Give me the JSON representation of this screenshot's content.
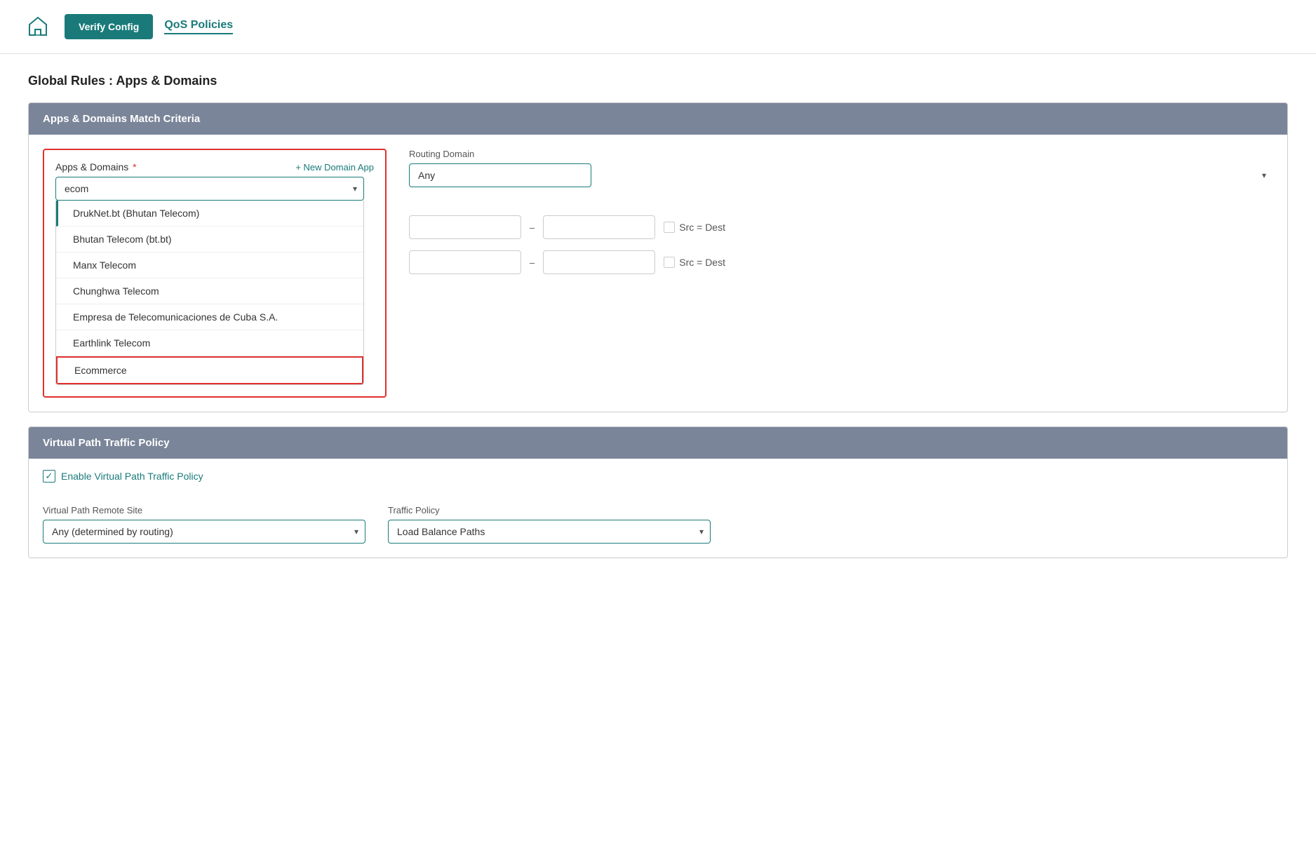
{
  "header": {
    "verify_config_label": "Verify Config",
    "qos_policies_label": "QoS Policies"
  },
  "page": {
    "title": "Global Rules : Apps & Domains"
  },
  "match_criteria_section": {
    "header": "Apps & Domains Match Criteria",
    "apps_domains_label": "Apps & Domains",
    "new_domain_app_link": "+ New Domain App",
    "search_value": "ecom",
    "dropdown_items": [
      {
        "label": "DrukNet.bt (Bhutan Telecom)",
        "first": true
      },
      {
        "label": "Bhutan Telecom (bt.bt)"
      },
      {
        "label": "Manx Telecom"
      },
      {
        "label": "Chunghwa Telecom"
      },
      {
        "label": "Empresa de Telecomunicaciones de Cuba S.A."
      },
      {
        "label": "Earthlink Telecom"
      },
      {
        "label": "Ecommerce",
        "highlighted": true
      }
    ],
    "routing_domain_label": "Routing Domain",
    "routing_domain_value": "Any",
    "src_dest_label_1": "Src = Dest",
    "src_dest_label_2": "Src = Dest"
  },
  "virtual_path_section": {
    "header": "Virtual Path Traffic Policy",
    "enable_label": "Enable Virtual Path Traffic Policy",
    "remote_site_label": "Virtual Path Remote Site",
    "remote_site_value": "Any (determined by routing)",
    "traffic_policy_label": "Traffic Policy",
    "traffic_policy_value": "Load Balance Paths"
  },
  "icons": {
    "home": "⌂",
    "chevron_down": "▾",
    "checkmark": "✓"
  }
}
